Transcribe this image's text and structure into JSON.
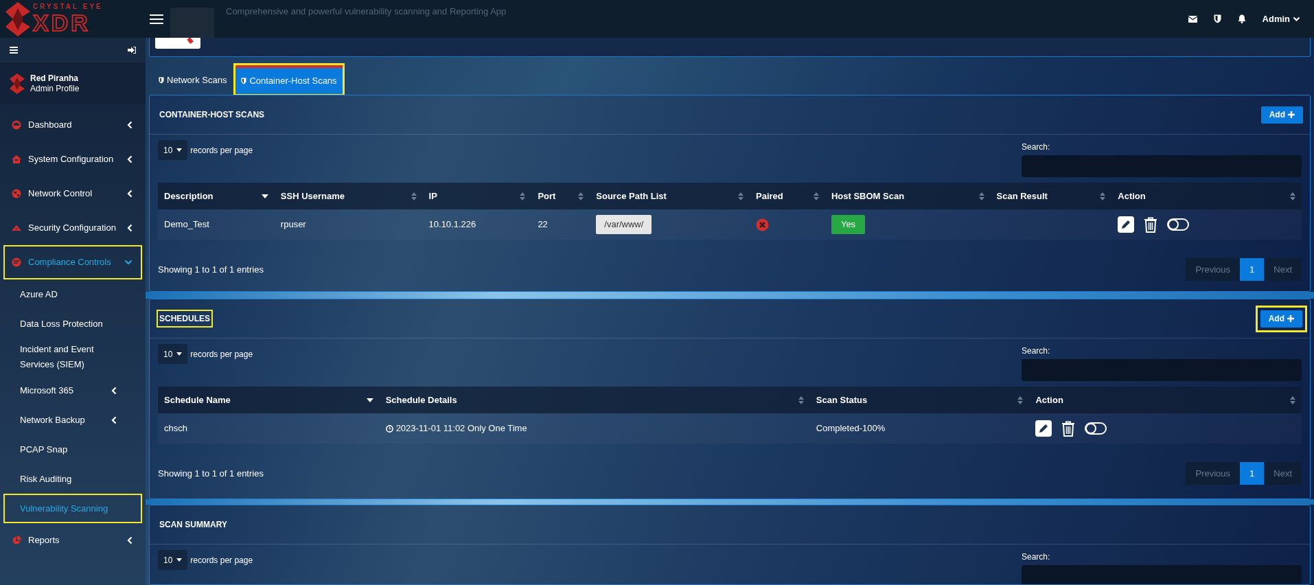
{
  "header": {
    "app_tagline": "Comprehensive and powerful vulnerability scanning and Reporting App",
    "user": "Admin"
  },
  "logo": {
    "tagline": "CRYSTAL EYE",
    "wordmark": "XDR"
  },
  "profile": {
    "name": "Red Piranha",
    "role": "Admin Profile"
  },
  "sidebar": {
    "items": [
      {
        "label": "Dashboard",
        "kind": "group",
        "expanded": false,
        "selected": false,
        "highlighted": false
      },
      {
        "label": "System Configuration",
        "kind": "group",
        "expanded": false,
        "selected": false,
        "highlighted": false
      },
      {
        "label": "Network Control",
        "kind": "group",
        "expanded": false,
        "selected": false,
        "highlighted": false
      },
      {
        "label": "Security Configuration",
        "kind": "group",
        "expanded": false,
        "selected": false,
        "highlighted": false
      },
      {
        "label": "Compliance Controls",
        "kind": "group",
        "expanded": true,
        "selected": true,
        "highlighted": true,
        "children": [
          {
            "label": "Azure AD",
            "kind": "link",
            "selected": false,
            "highlighted": false
          },
          {
            "label": "Data Loss Protection",
            "kind": "link",
            "selected": false,
            "highlighted": false
          },
          {
            "label": "Incident and Event Services (SIEM)",
            "kind": "link",
            "selected": false,
            "highlighted": false
          },
          {
            "label": "Microsoft 365",
            "kind": "group",
            "expanded": false,
            "selected": false,
            "highlighted": false
          },
          {
            "label": "Network Backup",
            "kind": "group",
            "expanded": false,
            "selected": false,
            "highlighted": false
          },
          {
            "label": "PCAP Snap",
            "kind": "link",
            "selected": false,
            "highlighted": false
          },
          {
            "label": "Risk Auditing",
            "kind": "link",
            "selected": false,
            "highlighted": false
          },
          {
            "label": "Vulnerability Scanning",
            "kind": "link",
            "selected": true,
            "highlighted": true
          }
        ]
      },
      {
        "label": "Reports",
        "kind": "group",
        "expanded": false,
        "selected": false,
        "highlighted": false
      }
    ]
  },
  "tabs": [
    {
      "label": "Network Scans",
      "selected": false,
      "highlighted": false
    },
    {
      "label": "Container-Host Scans",
      "selected": true,
      "highlighted": true
    }
  ],
  "panels": [
    {
      "title": "CONTAINER-HOST SCANS",
      "highlighted": false,
      "add_button": {
        "label": "Add",
        "highlighted": false
      },
      "records": {
        "value": "10",
        "label": "records per page"
      },
      "search_label": "Search:",
      "table": {
        "columns": [
          {
            "label": "Description",
            "sorted": true
          },
          {
            "label": "SSH Username",
            "sorted": false
          },
          {
            "label": "IP",
            "sorted": false
          },
          {
            "label": "Port",
            "sorted": false
          },
          {
            "label": "Source Path List",
            "sorted": false
          },
          {
            "label": "Paired",
            "sorted": false
          },
          {
            "label": "Host SBOM Scan",
            "sorted": false
          },
          {
            "label": "Scan Result",
            "sorted": false
          },
          {
            "label": "Action",
            "sorted": false
          }
        ],
        "rows": [
          [
            {
              "kind": "text",
              "text": "Demo_Test"
            },
            {
              "kind": "text",
              "text": "rpuser"
            },
            {
              "kind": "text",
              "text": "10.10.1.226"
            },
            {
              "kind": "text",
              "text": "22"
            },
            {
              "kind": "tag",
              "text": "/var/www/"
            },
            {
              "kind": "paired",
              "paired": false
            },
            {
              "kind": "badge",
              "text": "Yes"
            },
            {
              "kind": "empty"
            },
            {
              "kind": "actions",
              "enabled": false
            }
          ]
        ]
      },
      "info": "Showing 1 to 1 of 1 entries",
      "pagination": [
        {
          "label": "Previous",
          "selected": false,
          "disabled": true
        },
        {
          "label": "1",
          "selected": true,
          "disabled": false
        },
        {
          "label": "Next",
          "selected": false,
          "disabled": true
        }
      ]
    },
    {
      "title": "SCHEDULES",
      "highlighted": true,
      "add_button": {
        "label": "Add",
        "highlighted": true
      },
      "records": {
        "value": "10",
        "label": "records per page"
      },
      "search_label": "Search:",
      "table": {
        "columns": [
          {
            "label": "Schedule Name",
            "sorted": true
          },
          {
            "label": "Schedule Details",
            "sorted": false
          },
          {
            "label": "Scan Status",
            "sorted": false
          },
          {
            "label": "Action",
            "sorted": false
          }
        ],
        "rows": [
          [
            {
              "kind": "text",
              "text": "chsch"
            },
            {
              "kind": "time",
              "text": "2023-11-01 11:02 Only One Time"
            },
            {
              "kind": "text",
              "text": "Completed-100%"
            },
            {
              "kind": "actions",
              "enabled": false
            }
          ]
        ]
      },
      "info": "Showing 1 to 1 of 1 entries",
      "pagination": [
        {
          "label": "Previous",
          "selected": false,
          "disabled": true
        },
        {
          "label": "1",
          "selected": true,
          "disabled": false
        },
        {
          "label": "Next",
          "selected": false,
          "disabled": true
        }
      ]
    },
    {
      "title": "SCAN SUMMARY",
      "highlighted": false,
      "records": {
        "value": "10",
        "label": "records per page"
      },
      "search_label": "Search:"
    }
  ]
}
